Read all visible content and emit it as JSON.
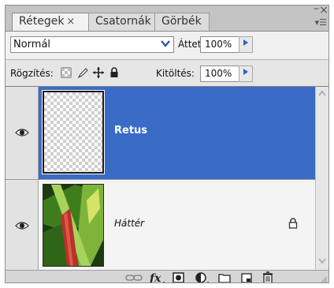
{
  "tabs": [
    {
      "label": "Rétegek",
      "close": "×",
      "active": true
    },
    {
      "label": "Csatornák",
      "active": false
    },
    {
      "label": "Görbék",
      "active": false
    }
  ],
  "window": {
    "minimize": "–",
    "close": "×",
    "panel_menu": "▾☰"
  },
  "blend": {
    "mode": "Normál",
    "opacity_label": "Áttetsz.:",
    "opacity_value": "100%"
  },
  "lock": {
    "label": "Rögzítés:",
    "fill_label": "Kitöltés:",
    "fill_value": "100%"
  },
  "layers": [
    {
      "name": "Retus",
      "visible": true,
      "selected": true
    },
    {
      "name": "Háttér",
      "visible": true,
      "locked": true
    }
  ],
  "icons": {
    "eye": "eye-icon",
    "lock": "lock-icon",
    "link": "link-layers-icon",
    "fx": "fx",
    "mask": "add-mask-icon",
    "adjustment": "adjustment-layer-icon",
    "group": "folder-icon",
    "new_layer": "new-layer-icon",
    "delete": "trash-icon"
  },
  "colors": {
    "selected_layer": "#3a6bc6",
    "panel_bg": "#d7d7d7",
    "arrow_blue": "#2b64c6"
  }
}
